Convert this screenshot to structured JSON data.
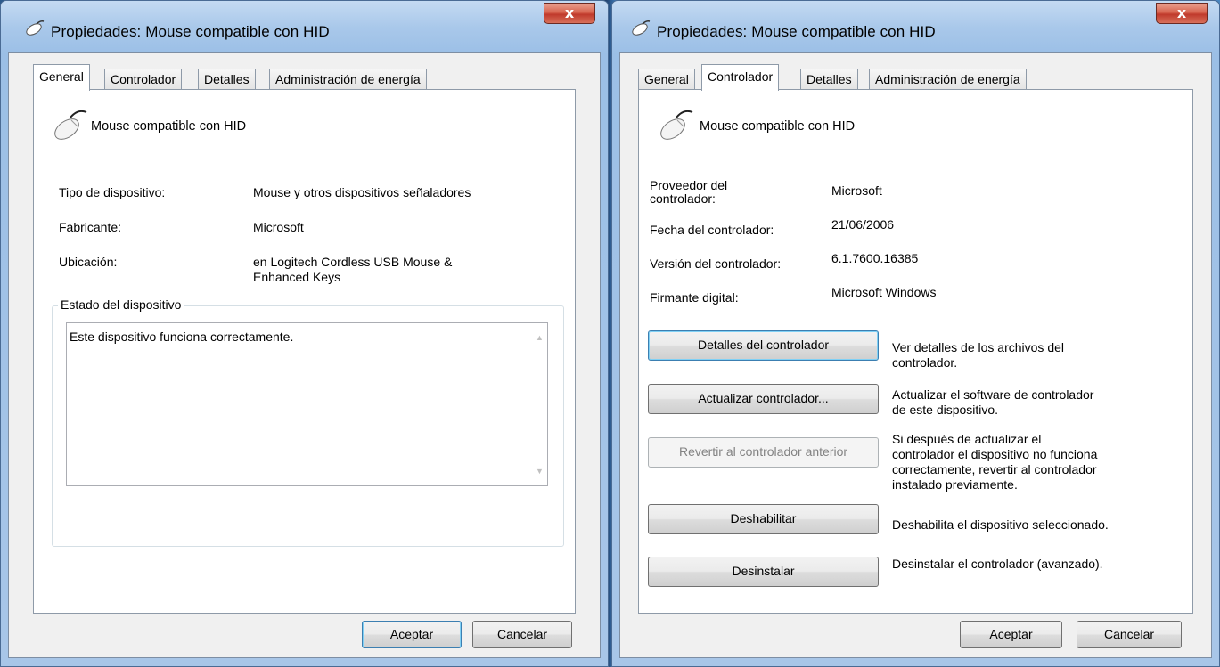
{
  "left_window": {
    "title": "Propiedades: Mouse compatible con HID",
    "close_label": "x",
    "tabs": [
      "General",
      "Controlador",
      "Detalles",
      "Administración de energía"
    ],
    "active_tab": "General",
    "device_name": "Mouse compatible con HID",
    "rows": [
      {
        "label": "Tipo de dispositivo:",
        "value": "Mouse y otros dispositivos señaladores"
      },
      {
        "label": "Fabricante:",
        "value": "Microsoft"
      },
      {
        "label": "Ubicación:",
        "value": "en Logitech Cordless USB Mouse &\nEnhanced Keys"
      }
    ],
    "status_group_title": "Estado del dispositivo",
    "status_text": "Este dispositivo funciona correctamente.",
    "ok_label": "Aceptar",
    "cancel_label": "Cancelar"
  },
  "right_window": {
    "title": "Propiedades: Mouse compatible con HID",
    "close_label": "x",
    "tabs": [
      "General",
      "Controlador",
      "Detalles",
      "Administración de energía"
    ],
    "active_tab": "Controlador",
    "device_name": "Mouse compatible con HID",
    "rows": [
      {
        "label": "Proveedor del\ncontrolador:",
        "value": "Microsoft"
      },
      {
        "label": "Fecha del controlador:",
        "value": "21/06/2006"
      },
      {
        "label": "Versión del controlador:",
        "value": "6.1.7600.16385"
      },
      {
        "label": "Firmante digital:",
        "value": "Microsoft Windows"
      }
    ],
    "actions": [
      {
        "button": "Detalles del controlador",
        "description": "Ver detalles de los archivos del\ncontrolador.",
        "enabled": true
      },
      {
        "button": "Actualizar controlador...",
        "description": "Actualizar el software de controlador\nde este dispositivo.",
        "enabled": true
      },
      {
        "button": "Revertir al controlador anterior",
        "description": "Si después de actualizar el\ncontrolador el dispositivo no funciona\ncorrectamente, revertir al controlador\ninstalado previamente.",
        "enabled": false
      },
      {
        "button": "Deshabilitar",
        "description": "Deshabilita el dispositivo seleccionado.",
        "enabled": true
      },
      {
        "button": "Desinstalar",
        "description": "Desinstalar el controlador (avanzado).",
        "enabled": true
      }
    ],
    "ok_label": "Aceptar",
    "cancel_label": "Cancelar"
  },
  "colors": {
    "close_button": "#c0392b",
    "default_button_border": "#3c7fb1",
    "window_frame": "#a9c8ea"
  },
  "icons": [
    "mouse-icon",
    "close-icon",
    "scroll-up-icon",
    "scroll-down-icon"
  ]
}
